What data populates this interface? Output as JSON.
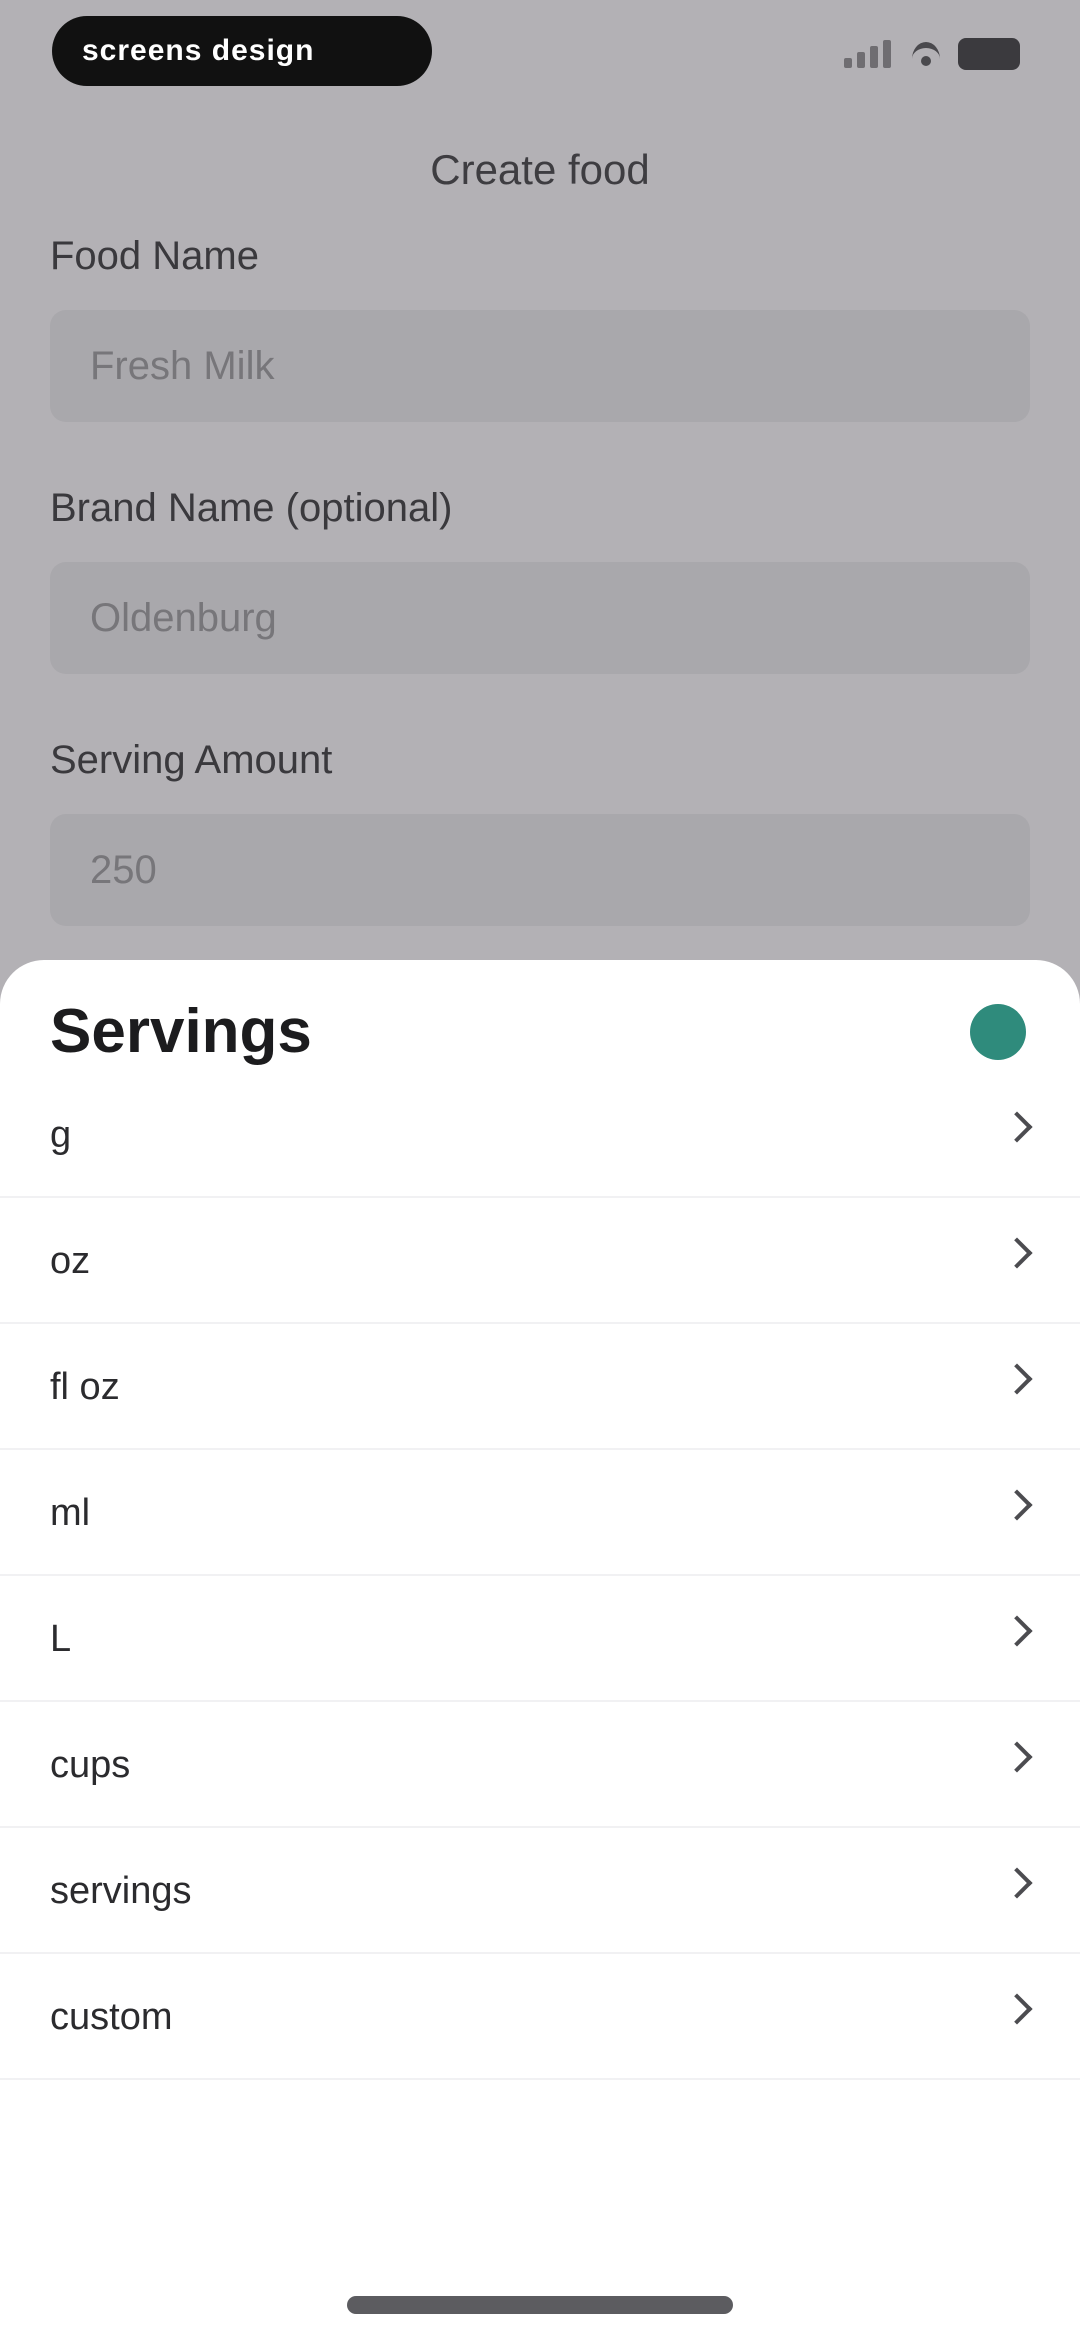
{
  "status_bar": {
    "pill_text": "screens design"
  },
  "page": {
    "title": "Create food",
    "fields": [
      {
        "label": "Food Name",
        "value": "Fresh Milk"
      },
      {
        "label": "Brand Name (optional)",
        "value": "Oldenburg"
      },
      {
        "label": "Serving Amount",
        "value": "250"
      }
    ]
  },
  "sheet": {
    "title": "Servings",
    "options": [
      "g",
      "oz",
      "fl oz",
      "ml",
      "L",
      "cups",
      "servings",
      "custom"
    ]
  }
}
